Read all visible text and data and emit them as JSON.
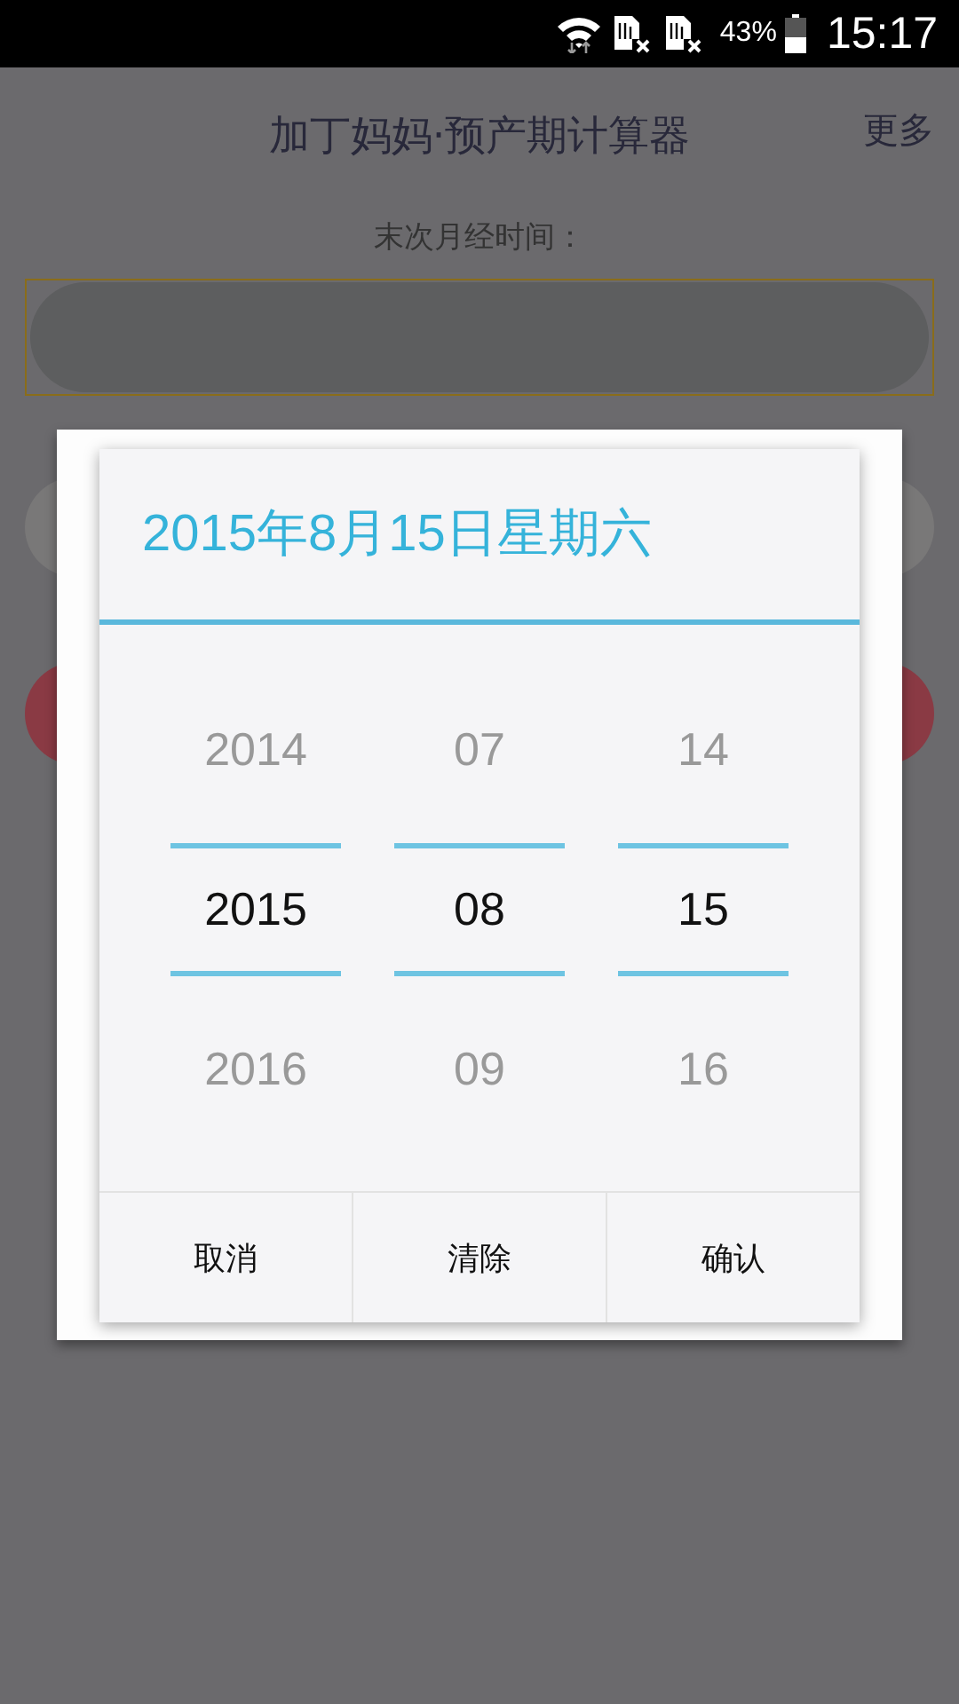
{
  "status_bar": {
    "battery": "43%",
    "time": "15:17"
  },
  "header": {
    "title": "加丁妈妈·预产期计算器",
    "menu": "更多"
  },
  "form": {
    "label": "末次月经时间："
  },
  "dialog": {
    "title": "2015年8月15日星期六",
    "columns": [
      {
        "items": [
          {
            "text": "2014",
            "selected": false
          },
          {
            "text": "2015",
            "selected": true
          },
          {
            "text": "2016",
            "selected": false
          }
        ]
      },
      {
        "items": [
          {
            "text": "07",
            "selected": false
          },
          {
            "text": "08",
            "selected": true
          },
          {
            "text": "09",
            "selected": false
          }
        ]
      },
      {
        "items": [
          {
            "text": "14",
            "selected": false
          },
          {
            "text": "15",
            "selected": true
          },
          {
            "text": "16",
            "selected": false
          }
        ]
      }
    ],
    "buttons": [
      "取消",
      "清除",
      "确认"
    ]
  }
}
